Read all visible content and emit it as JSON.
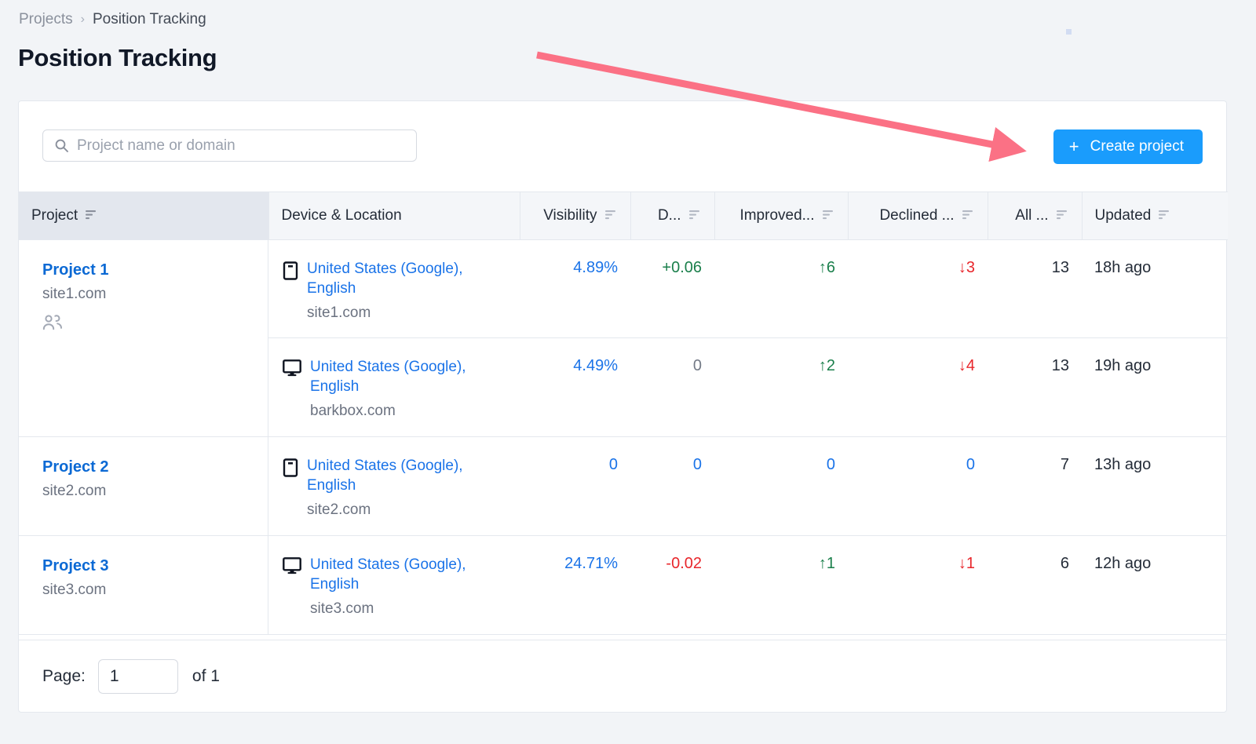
{
  "breadcrumb": {
    "parent": "Projects",
    "separator": "›",
    "current": "Position Tracking"
  },
  "page": {
    "title": "Position Tracking"
  },
  "toolbar": {
    "search_placeholder": "Project name or domain",
    "search_value": "",
    "create_label": "Create project",
    "create_plus": "+"
  },
  "table": {
    "headers": [
      {
        "label": "Project",
        "sorted": true
      },
      {
        "label": "Device & Location",
        "sorted": false
      },
      {
        "label": "Visibility",
        "sorted": false
      },
      {
        "label": "D...",
        "sorted": false
      },
      {
        "label": "Improved...",
        "sorted": false
      },
      {
        "label": "Declined ...",
        "sorted": false
      },
      {
        "label": "All ...",
        "sorted": false
      },
      {
        "label": "Updated",
        "sorted": false
      }
    ],
    "groups": [
      {
        "project": {
          "name": "Project 1",
          "domain": "site1.com",
          "shared": true
        },
        "rows": [
          {
            "device": "mobile-icon",
            "location": "United States (Google), English",
            "domain": "site1.com",
            "visibility": "4.89%",
            "diff": "+0.06",
            "improved": "↑6",
            "declined": "↓3",
            "all": "13",
            "updated": "18h ago",
            "colors": {
              "visibility": "blue",
              "diff": "green",
              "improved": "green",
              "declined": "red",
              "all": "dark"
            }
          },
          {
            "device": "desktop-icon",
            "location": "United States (Google), English",
            "domain": "barkbox.com",
            "visibility": "4.49%",
            "diff": "0",
            "improved": "↑2",
            "declined": "↓4",
            "all": "13",
            "updated": "19h ago",
            "colors": {
              "visibility": "blue",
              "diff": "gray",
              "improved": "green",
              "declined": "red",
              "all": "dark"
            }
          }
        ]
      },
      {
        "project": {
          "name": "Project 2",
          "domain": "site2.com",
          "shared": false
        },
        "rows": [
          {
            "device": "mobile-icon",
            "location": "United States (Google), English",
            "domain": "site2.com",
            "visibility": "0",
            "diff": "0",
            "improved": "0",
            "declined": "0",
            "all": "7",
            "updated": "13h ago",
            "colors": {
              "visibility": "blue",
              "diff": "blue",
              "improved": "blue",
              "declined": "blue",
              "all": "dark"
            }
          }
        ]
      },
      {
        "project": {
          "name": "Project 3",
          "domain": "site3.com",
          "shared": false
        },
        "rows": [
          {
            "device": "desktop-icon",
            "location": "United States (Google), English",
            "domain": "site3.com",
            "visibility": "24.71%",
            "diff": "-0.02",
            "improved": "↑1",
            "declined": "↓1",
            "all": "6",
            "updated": "12h ago",
            "colors": {
              "visibility": "blue",
              "diff": "red",
              "improved": "green",
              "declined": "red",
              "all": "dark"
            }
          }
        ]
      }
    ]
  },
  "footer": {
    "page_label": "Page:",
    "page_value": "1",
    "of_label": "of 1"
  },
  "annotation": {
    "arrow_color": "#fb7185"
  },
  "colors": {
    "accent_blue": "#1a9cfc",
    "link_blue": "#1a73e8",
    "positive_green": "#1a7f4b",
    "negative_red": "#e8262b",
    "header_bg": "#f4f6f9",
    "sorted_header_bg": "#e3e7ee"
  }
}
